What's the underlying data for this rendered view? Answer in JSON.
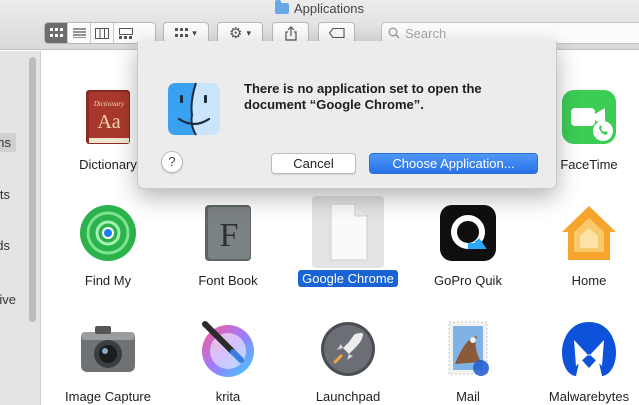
{
  "window": {
    "title": "Applications"
  },
  "toolbar": {
    "view_buttons": [
      "icon-view",
      "list-view",
      "column-view",
      "gallery-view"
    ],
    "search_placeholder": "Search"
  },
  "sidebar": {
    "items": [
      {
        "label": "ons",
        "selected": true
      },
      {
        "label": "ts",
        "selected": false
      },
      {
        "label": "ds",
        "selected": false
      },
      {
        "label": "ive",
        "selected": false
      }
    ]
  },
  "apps": [
    {
      "name": "Dictionary"
    },
    {
      "name": "FaceTime"
    },
    {
      "name": "Find My"
    },
    {
      "name": "Font Book"
    },
    {
      "name": "Google Chrome",
      "selected": true
    },
    {
      "name": "GoPro Quik"
    },
    {
      "name": "Home"
    },
    {
      "name": "Image Capture"
    },
    {
      "name": "krita"
    },
    {
      "name": "Launchpad"
    },
    {
      "name": "Mail"
    },
    {
      "name": "Malwarebytes"
    }
  ],
  "dialog": {
    "message": "There is no application set to open the document “Google Chrome”.",
    "help_label": "?",
    "cancel_label": "Cancel",
    "choose_label": "Choose Application..."
  },
  "colors": {
    "accent": "#1964d5",
    "dialog_bg": "#ececec",
    "toolbar_bg": "#dcdcdc"
  }
}
